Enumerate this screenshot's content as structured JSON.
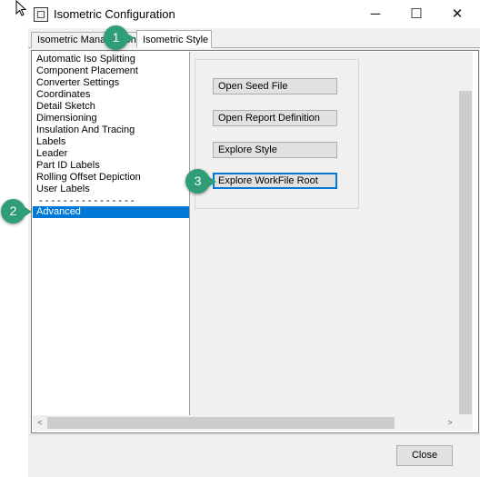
{
  "window": {
    "title": "Isometric Configuration",
    "minimize_symbol": "─",
    "maximize_symbol": "☐",
    "close_symbol": "✕",
    "close_button_label": "Close"
  },
  "tabs": [
    {
      "label": "Isometric Management",
      "active": false
    },
    {
      "label": "Isometric Style",
      "active": true
    }
  ],
  "list": {
    "items": [
      "Automatic Iso Splitting",
      "Component Placement",
      "Converter Settings",
      "Coordinates",
      "Detail Sketch",
      "Dimensioning",
      "Insulation And Tracing",
      "Labels",
      "Leader",
      "Part ID Labels",
      "Rolling Offset Depiction",
      "User Labels",
      "- - - - - - - - - - - - - - - -",
      "Advanced"
    ],
    "selected_index": 13
  },
  "actions": {
    "open_seed": "Open Seed File",
    "open_report": "Open Report Definition",
    "explore_style": "Explore Style",
    "explore_workfile": "Explore WorkFile Root"
  },
  "scroll": {
    "left_arrow": "<",
    "right_arrow": ">"
  },
  "callouts": [
    "1",
    "2",
    "3"
  ],
  "colors": {
    "selection": "#0078d7",
    "callout": "#2f9e77",
    "focus_border": "#0078d7"
  }
}
